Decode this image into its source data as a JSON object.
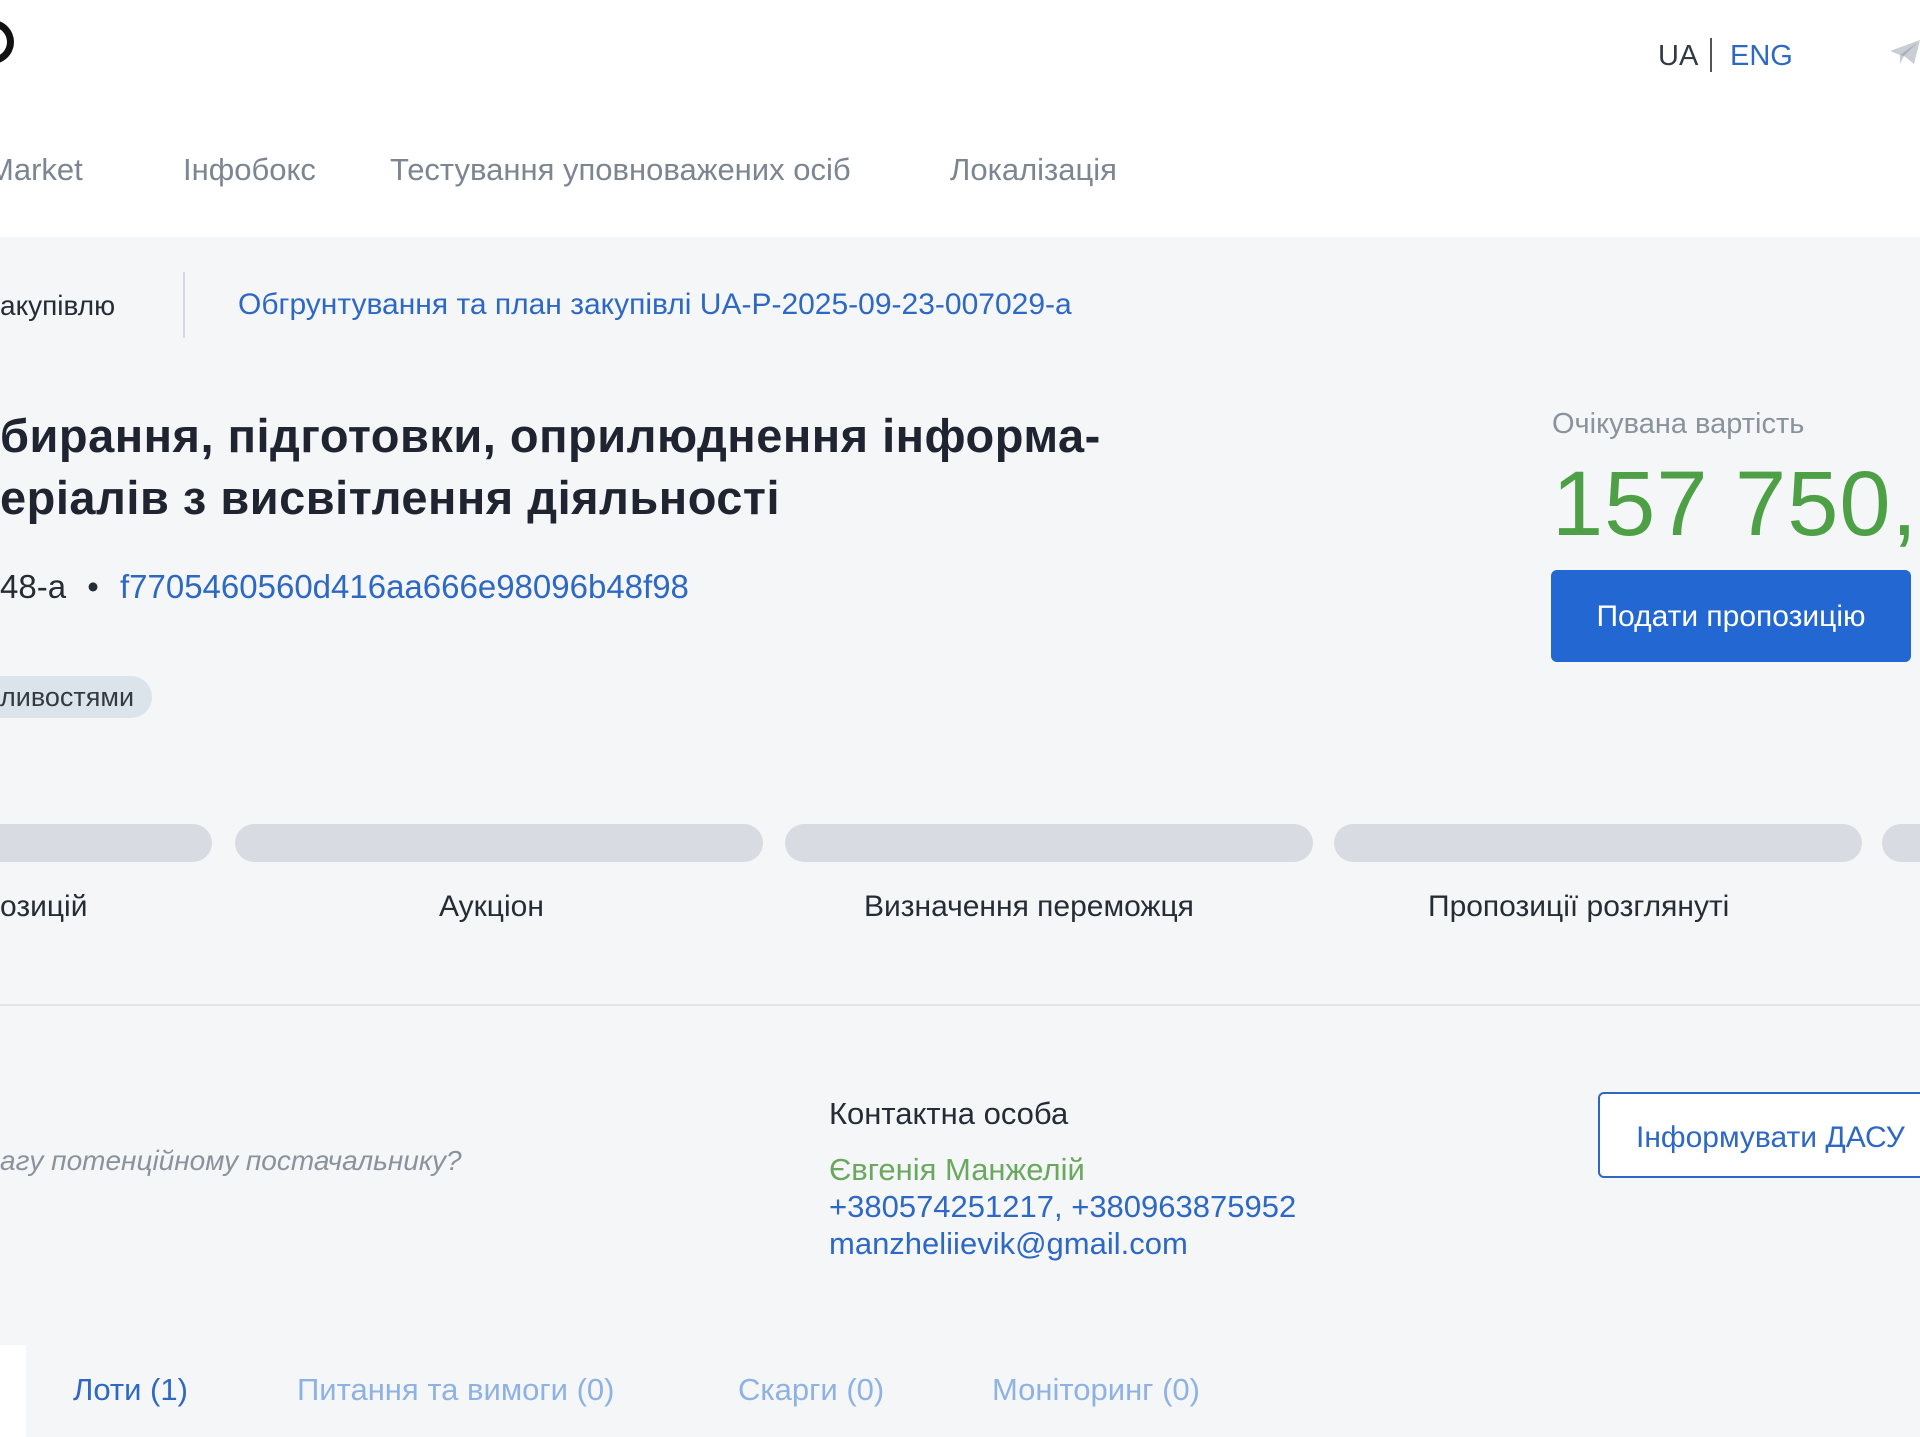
{
  "header": {
    "lang": {
      "ua": "UA",
      "eng": "ENG"
    },
    "nav": [
      "Market",
      "Інфобокс",
      "Тестування уповноважених осіб",
      "Локалізація"
    ]
  },
  "breadcrumb": {
    "left": "акупівлю",
    "link": "Обгрунтування та план закупівлі UA-P-2025-09-23-007029-a"
  },
  "tender": {
    "title_lines": [
      "бирання, підготовки, оприлюднення інформа-",
      "еріалів з висвітлення діяльності"
    ],
    "id_part": "48-a",
    "separator": "•",
    "hash": "f7705460560d416aa666e98096b48f98",
    "tag": "ливостями"
  },
  "value": {
    "label": "Очікувана вартість",
    "amount": "157 750,",
    "submit_label": "Подати пропозицію",
    "amount_color": "#4ea046"
  },
  "stages": [
    "озицій",
    "Аукціон",
    "Визначення переможця",
    "Пропозиції розглянуті"
  ],
  "contact": {
    "hint": "агу потенційному постачальнику?",
    "title": "Контактна особа",
    "name": "Євгенія Манжелій",
    "phones": "+380574251217, +380963875952",
    "email": "manzheliievik@gmail.com",
    "dasu_label": "Інформувати ДАСУ"
  },
  "tabs": [
    {
      "label": "Лоти (1)",
      "active": true
    },
    {
      "label": "Питання та вимоги (0)",
      "active": false
    },
    {
      "label": "Скарги (0)",
      "active": false
    },
    {
      "label": "Моніторинг (0)",
      "active": false
    }
  ],
  "colors": {
    "accent": "#2367d2",
    "link": "#2d68c4",
    "success": "#4ea046"
  },
  "icons": [
    "telegram-icon"
  ]
}
